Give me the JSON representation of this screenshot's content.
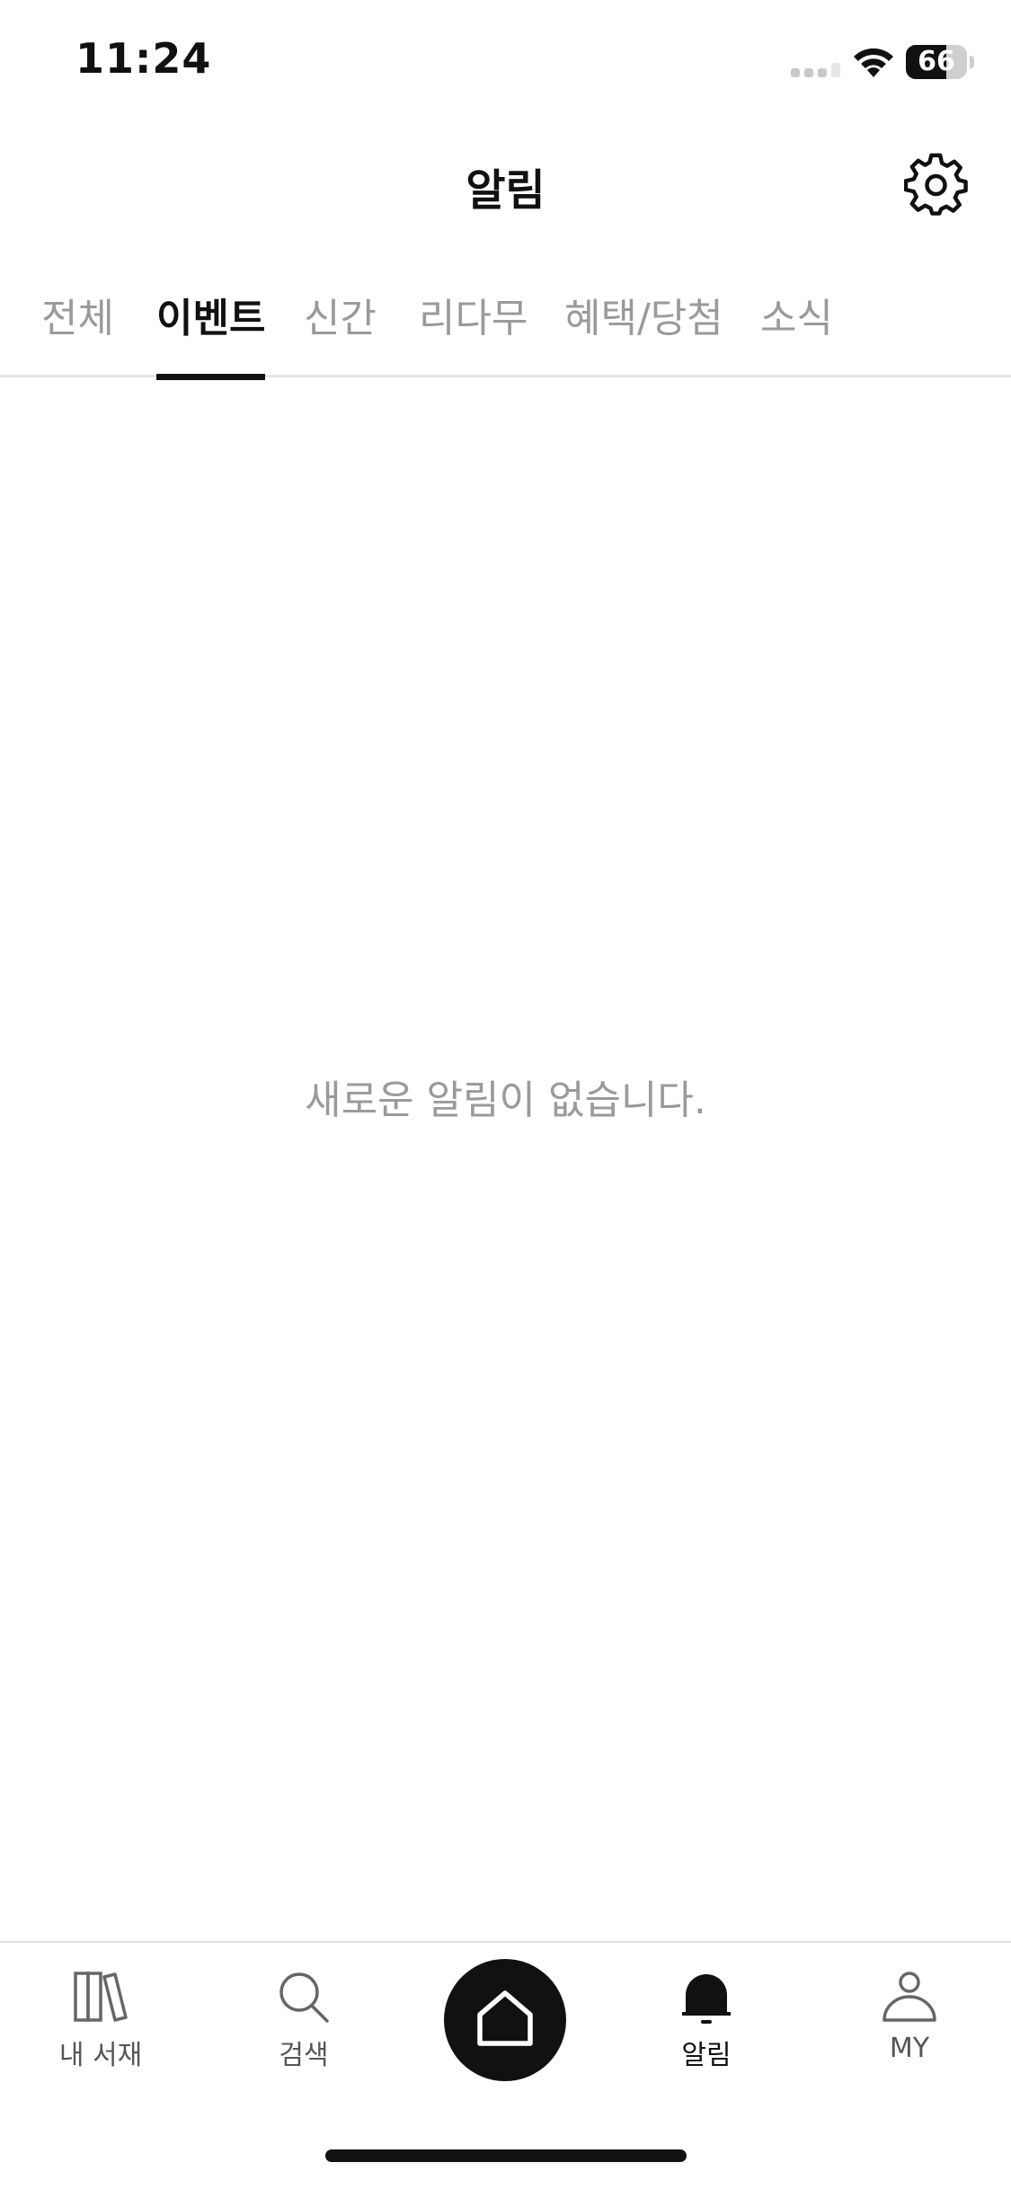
{
  "status_bar": {
    "time": "11:24",
    "battery_level": "66",
    "battery_percent": 66
  },
  "header": {
    "title": "알림",
    "settings_icon": "gear-icon"
  },
  "tabs": [
    {
      "label": "전체",
      "active": false
    },
    {
      "label": "이벤트",
      "active": true
    },
    {
      "label": "신간",
      "active": false
    },
    {
      "label": "리다무",
      "active": false
    },
    {
      "label": "혜택/당첨",
      "active": false
    },
    {
      "label": "소식",
      "active": false
    }
  ],
  "main": {
    "empty_message": "새로운 알림이 없습니다."
  },
  "bottom_nav": {
    "items": [
      {
        "label": "내 서재",
        "icon": "bookshelf-icon",
        "active": false
      },
      {
        "label": "검색",
        "icon": "search-icon",
        "active": false
      },
      {
        "label": "",
        "icon": "home-icon",
        "active": false
      },
      {
        "label": "알림",
        "icon": "bell-icon",
        "active": true
      },
      {
        "label": "MY",
        "icon": "person-icon",
        "active": false
      }
    ]
  },
  "colors": {
    "active": "#111111",
    "inactive": "#9a9a9a",
    "divider": "#e6e6e6",
    "background": "#ffffff"
  }
}
